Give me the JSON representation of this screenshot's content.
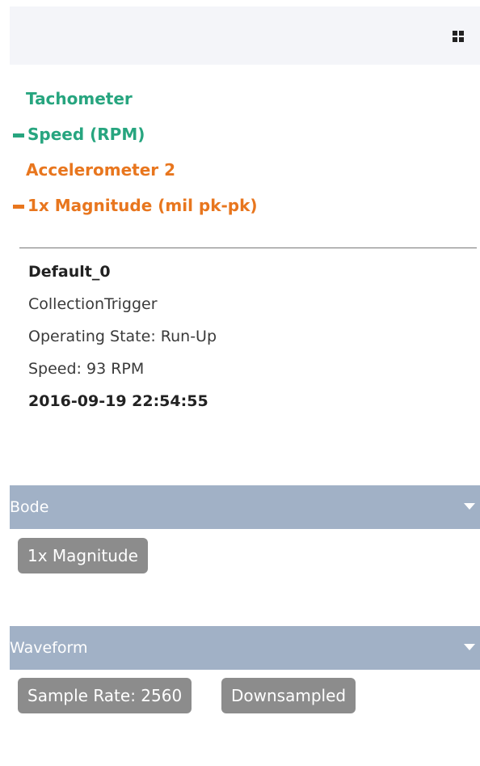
{
  "toolbar": {
    "grid_icon": "grid-icon"
  },
  "legend": {
    "groups": [
      {
        "name": "Tachometer",
        "series": "Speed (RPM)",
        "color": "#27a57f"
      },
      {
        "name": "Accelerometer 2",
        "series": "1x Magnitude (mil pk-pk)",
        "color": "#e8761e"
      }
    ]
  },
  "info": {
    "name": "Default_0",
    "trigger": "CollectionTrigger",
    "operating_state": "Operating State: Run-Up",
    "speed": "Speed: 93 RPM",
    "timestamp": "2016-09-19 22:54:55"
  },
  "sections": {
    "bode": {
      "title": "Bode",
      "chips": [
        "1x Magnitude"
      ]
    },
    "waveform": {
      "title": "Waveform",
      "chips": [
        "Sample Rate: 2560",
        "Downsampled"
      ]
    }
  },
  "colors": {
    "header_bg": "#a1b1c6",
    "chip_bg": "#8c8c8c",
    "topbar_bg": "#f4f5f9"
  }
}
